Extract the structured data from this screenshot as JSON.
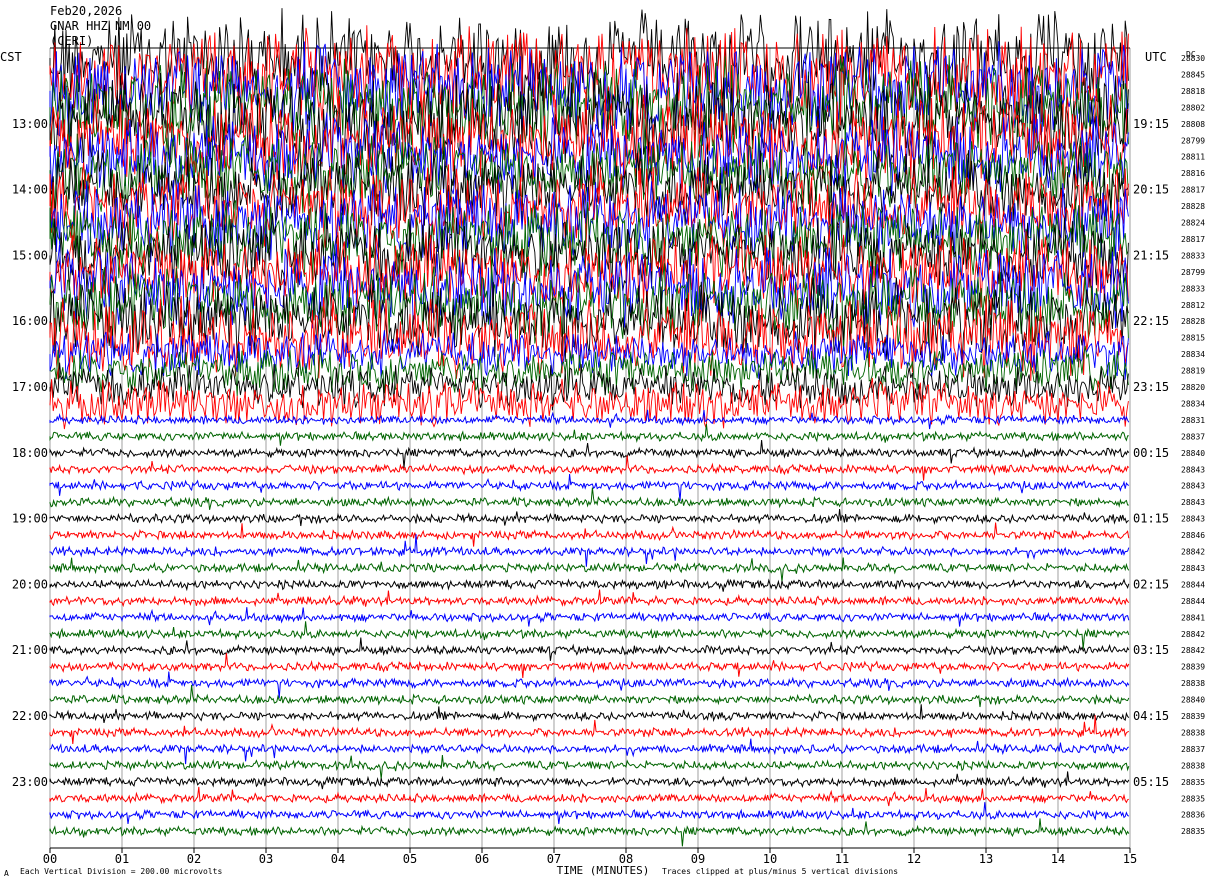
{
  "header": {
    "date": "Feb20,2026",
    "station": "GNAR HHZ NM 00",
    "agency": "(CERI)"
  },
  "left_timezone": "CST",
  "right_timezone": "UTC",
  "dc_label": "DC",
  "footer": {
    "scale_note": "Each Vertical Division =  200.00 microvolts",
    "clip_note": "Traces clipped at plus/minus 5 vertical divisions",
    "mark": "A"
  },
  "chart_data": {
    "type": "helicorder",
    "xlabel": "TIME (MINUTES)",
    "x_ticks": [
      "00",
      "01",
      "02",
      "03",
      "04",
      "05",
      "06",
      "07",
      "08",
      "09",
      "10",
      "11",
      "12",
      "13",
      "14",
      "15"
    ],
    "xlim": [
      0,
      15
    ],
    "left_hour_labels": [
      "13:00",
      "14:00",
      "15:00",
      "16:00",
      "17:00",
      "18:00",
      "19:00",
      "20:00",
      "21:00",
      "22:00",
      "23:00"
    ],
    "right_hour_labels": [
      "19:15",
      "20:15",
      "21:15",
      "22:15",
      "23:15",
      "00:15",
      "01:15",
      "02:15",
      "03:15",
      "04:15",
      "05:15"
    ],
    "dc_offsets": [
      "28830",
      "28845",
      "28818",
      "28802",
      "28808",
      "28799",
      "28811",
      "28816",
      "28817",
      "28828",
      "28824",
      "28817",
      "28833",
      "28799",
      "28833",
      "28812",
      "28828",
      "28815",
      "28834",
      "28819",
      "28820",
      "28834",
      "28831",
      "28837",
      "28840",
      "28843",
      "28843",
      "28843",
      "28843",
      "28846",
      "28842",
      "28843",
      "28844",
      "28844",
      "28841",
      "28842",
      "28842",
      "28839",
      "28838",
      "28840",
      "28839",
      "28838",
      "28837",
      "28838",
      "28835",
      "28835",
      "28836",
      "28835"
    ],
    "trace_colors": [
      "#000000",
      "#ff0000",
      "#0000ff",
      "#006400"
    ],
    "first_trace_color_index": 0,
    "num_traces": 48,
    "noisy_trace_count": 22,
    "clip_divisions": 5
  }
}
